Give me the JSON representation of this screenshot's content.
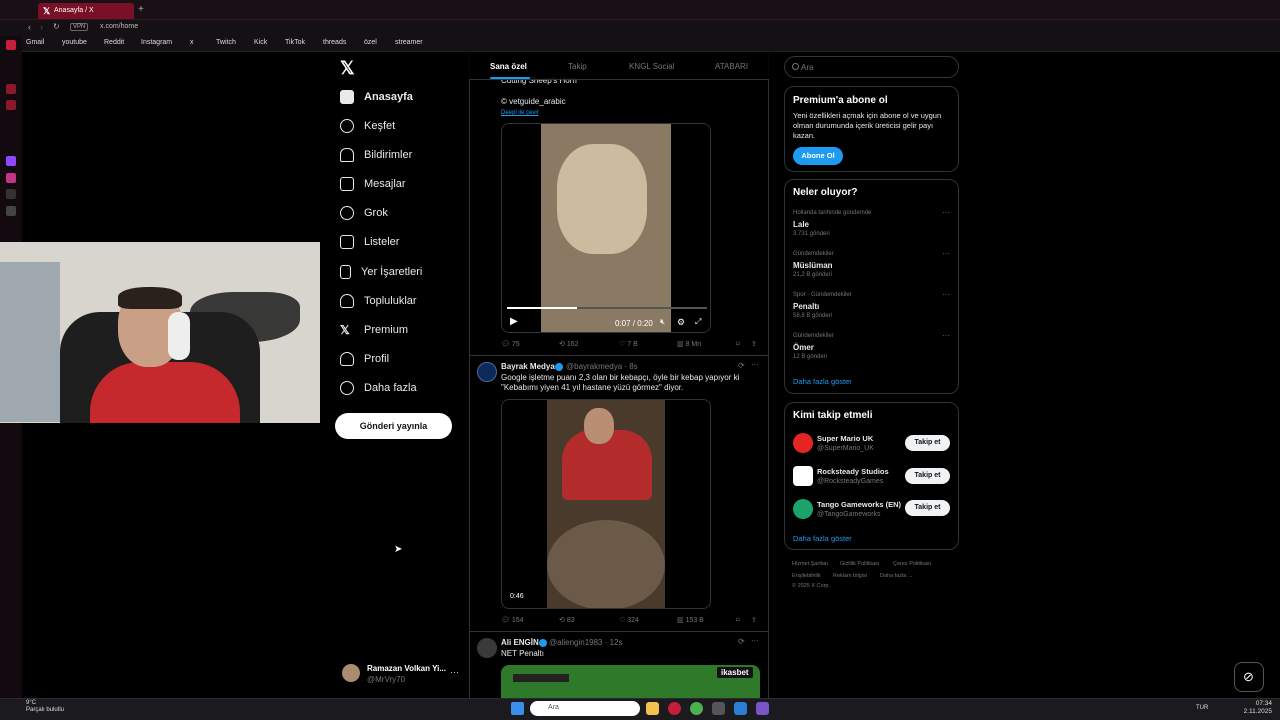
{
  "browser": {
    "tab_title": "Anasayfa / X",
    "url": "x.com/home",
    "vpn": "VPN",
    "bookmarks": [
      "Gmail",
      "youtube",
      "Reddit",
      "Instagram",
      "x",
      "Twitch",
      "Kick",
      "TikTok",
      "threads",
      "özel",
      "streamer"
    ]
  },
  "nav": {
    "items": [
      "Anasayfa",
      "Keşfet",
      "Bildirimler",
      "Mesajlar",
      "Grok",
      "Listeler",
      "Yer İşaretleri",
      "Topluluklar",
      "Premium",
      "Profil",
      "Daha fazla"
    ],
    "post_button": "Gönderi yayınla"
  },
  "profile": {
    "name": "Ramazan Volkan Yi...",
    "handle": "@MrVry70"
  },
  "feed": {
    "tabs": [
      "Sana özel",
      "Takip",
      "KNGL Social",
      "ATABARI"
    ],
    "post1": {
      "title": "Cutting Sheep's Horn",
      "credit": "© vetguide_arabic",
      "translate": "Deepl ile çevir",
      "time": "0:07 / 0:20",
      "stats": {
        "replies": "75",
        "reposts": "162",
        "likes": "7 B",
        "views": "8 Mn"
      }
    },
    "post2": {
      "author": "Bayrak Medya",
      "meta": "@bayrakmedya · 8s",
      "text1": "Google işletme puanı 2,3 olan bir kebapçı, öyle bir kebap yapıyor ki",
      "text2": "\"Kebabımı yiyen 41 yıl hastane yüzü görmez\" diyor.",
      "duration": "0:46",
      "stats": {
        "replies": "154",
        "reposts": "83",
        "likes": "324",
        "views": "153 B"
      }
    },
    "post3": {
      "author": "Ali ENGİN",
      "meta": "@aliengin1983 · 12s",
      "text": "NET Penaltı",
      "brand": "ikasbet"
    }
  },
  "right": {
    "search_placeholder": "Ara",
    "premium": {
      "title": "Premium'a abone ol",
      "body": "Yeni özellikleri açmak için abone ol ve uygun olman durumunda içerik üreticisi gelir payı kazan.",
      "button": "Abone Ol"
    },
    "trends_title": "Neler oluyor?",
    "trends": [
      {
        "category": "Hollanda tarihinde gündemde",
        "title": "Lale",
        "count": "3.731 gönderi"
      },
      {
        "category": "Gündemdekiler",
        "title": "Müslüman",
        "count": "21,2 B gönderi"
      },
      {
        "category": "Spor · Gündemdekiler",
        "title": "Penaltı",
        "count": "58,8 B gönderi"
      },
      {
        "category": "Gündemdekiler",
        "title": "Ömer",
        "count": "12 B gönderi"
      }
    ],
    "show_more": "Daha fazla göster",
    "who_title": "Kimi takip etmeli",
    "follow": [
      {
        "name": "Super Mario UK",
        "handle": "@SuperMario_UK",
        "color": "#e52521"
      },
      {
        "name": "Rocksteady Studios",
        "handle": "@RocksteadyGames",
        "color": "#ffffff"
      },
      {
        "name": "Tango Gameworks (EN)",
        "handle": "@TangoGameworks",
        "color": "#1aa36b"
      }
    ],
    "follow_button": "Takip et",
    "footer": [
      "Hizmet Şartları",
      "Gizlilik Politikası",
      "Çerez Politikası",
      "Erişilebilirlik",
      "Reklam bilgisi",
      "Daha fazla ...",
      "© 2025 X Corp."
    ]
  },
  "taskbar": {
    "search": "Ara",
    "weather_temp": "9°C",
    "weather_desc": "Parçalı bulutlu",
    "lang": "TUR",
    "time": "07:34",
    "date": "2.11.2025"
  },
  "colors": {
    "accent": "#1d9bf0",
    "tab": "#7a1028"
  }
}
